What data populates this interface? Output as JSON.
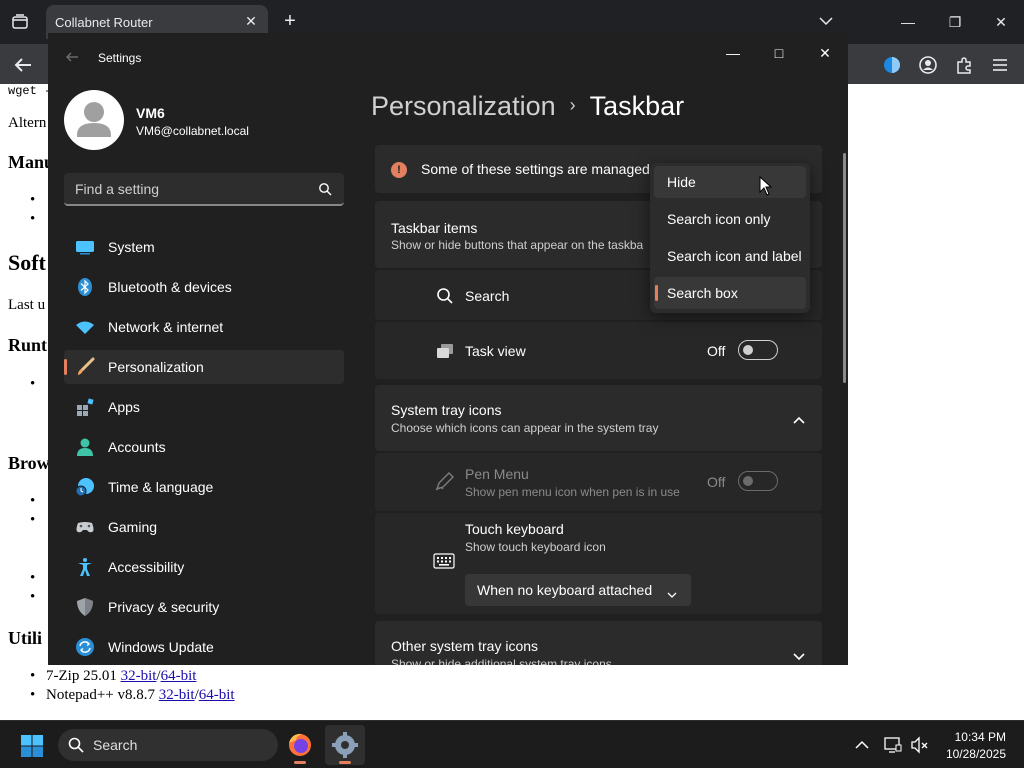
{
  "browser": {
    "tab_title": "Collabnet Router",
    "tab_close": "✕",
    "new_tab": "+",
    "minimize": "—",
    "restore": "❐",
    "close": "✕"
  },
  "webpage": {
    "line_wget": "wget -",
    "line_alt": "Altern",
    "heading_manual": "Manu",
    "heading_software": "Soft",
    "line_last": "Last u",
    "heading_runtime": "Runt",
    "heading_browser": "Brow",
    "heading_utilities": "Utili",
    "utilities": [
      {
        "name": "7-Zip 25.01 ",
        "link32": "32-bit",
        "sep": "/",
        "link64": "64-bit"
      },
      {
        "name": "Notepad++ v8.8.7 ",
        "link32": "32-bit",
        "sep": "/",
        "link64": "64-bit"
      }
    ]
  },
  "settings": {
    "window_title": "Settings",
    "minimize": "—",
    "maximize": "□",
    "close": "✕",
    "profile": {
      "name": "VM6",
      "email": "VM6@collabnet.local"
    },
    "search_placeholder": "Find a setting",
    "nav": [
      {
        "label": "System",
        "icon": "monitor-icon"
      },
      {
        "label": "Bluetooth & devices",
        "icon": "bluetooth-icon"
      },
      {
        "label": "Network & internet",
        "icon": "wifi-icon"
      },
      {
        "label": "Personalization",
        "icon": "brush-icon",
        "active": true
      },
      {
        "label": "Apps",
        "icon": "apps-icon"
      },
      {
        "label": "Accounts",
        "icon": "accounts-icon"
      },
      {
        "label": "Time & language",
        "icon": "globe-clock-icon"
      },
      {
        "label": "Gaming",
        "icon": "controller-icon"
      },
      {
        "label": "Accessibility",
        "icon": "accessibility-icon"
      },
      {
        "label": "Privacy & security",
        "icon": "shield-icon"
      },
      {
        "label": "Windows Update",
        "icon": "update-icon"
      }
    ],
    "breadcrumb": {
      "parent": "Personalization",
      "separator": "›",
      "current": "Taskbar"
    },
    "managed_notice": "Some of these settings are managed",
    "taskbar_items": {
      "title": "Taskbar items",
      "subtitle": "Show or hide buttons that appear on the taskba"
    },
    "search_row": {
      "label": "Search"
    },
    "task_view_row": {
      "label": "Task view",
      "state": "Off"
    },
    "system_tray": {
      "title": "System tray icons",
      "subtitle": "Choose which icons can appear in the system tray"
    },
    "pen_menu": {
      "title": "Pen Menu",
      "subtitle": "Show pen menu icon when pen is in use",
      "state": "Off"
    },
    "touch_keyboard": {
      "title": "Touch keyboard",
      "subtitle": "Show touch keyboard icon",
      "dropdown_value": "When no keyboard attached"
    },
    "other_tray": {
      "title": "Other system tray icons",
      "subtitle": "Show or hide additional system tray icons"
    },
    "search_options": [
      {
        "label": "Hide",
        "state": "hover"
      },
      {
        "label": "Search icon only",
        "state": ""
      },
      {
        "label": "Search icon and label",
        "state": ""
      },
      {
        "label": "Search box",
        "state": "selected"
      }
    ]
  },
  "taskbar": {
    "search_label": "Search",
    "time": "10:34 PM",
    "date": "10/28/2025"
  },
  "colors": {
    "accent": "#e2805f",
    "settings_bg": "#202020",
    "card_bg": "#2b2b2b",
    "taskbar_bg": "#1c1c1c"
  }
}
